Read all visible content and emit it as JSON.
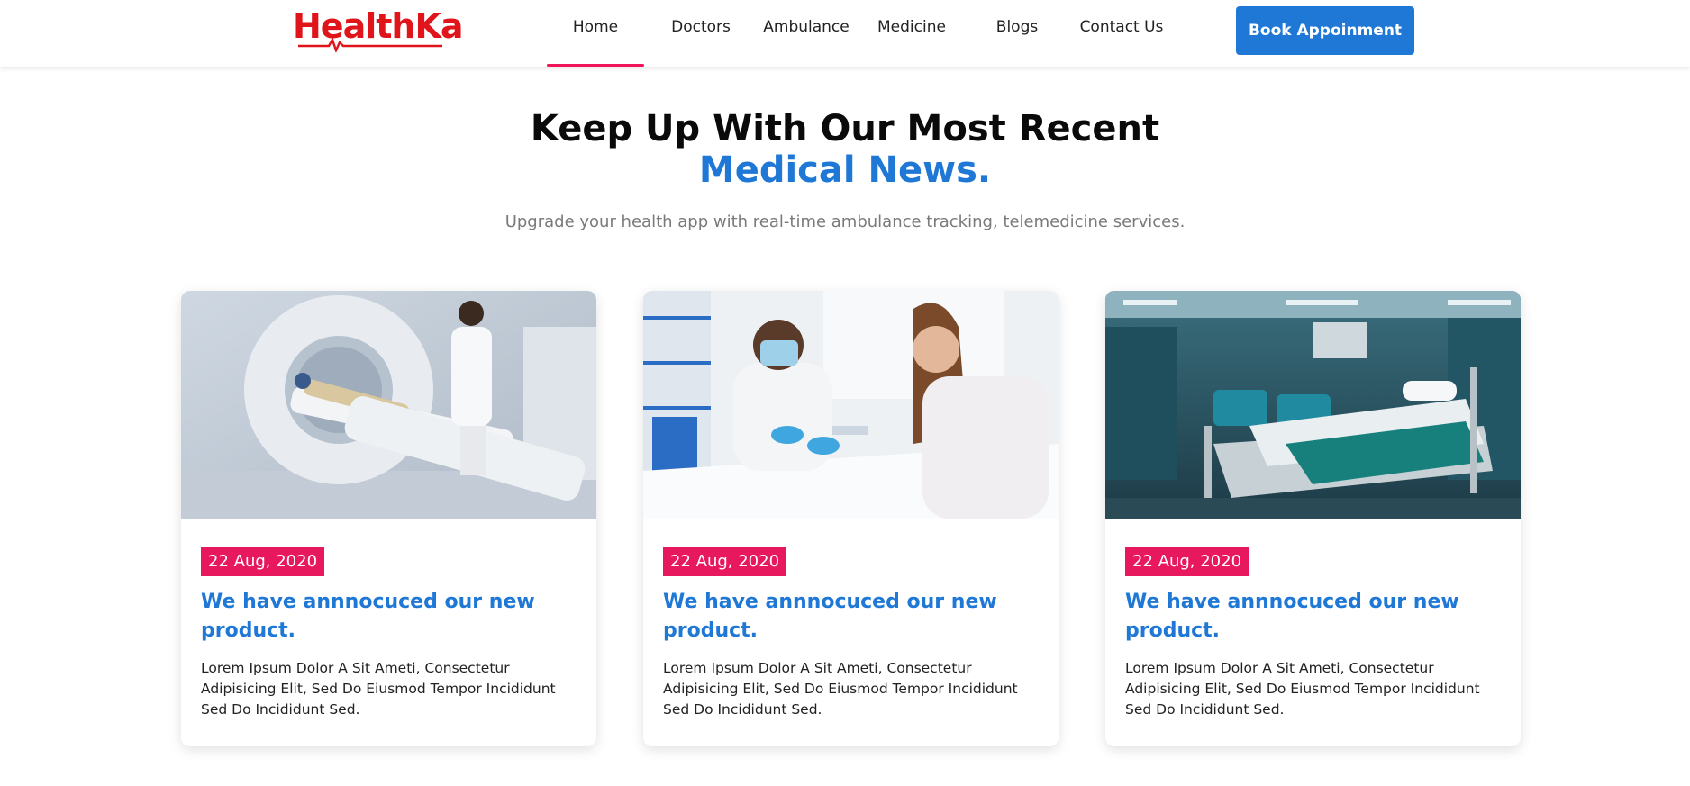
{
  "brand": {
    "logo_part1": "Health",
    "logo_part2": "Ka",
    "colors": {
      "red": "#e0151b",
      "blue": "#1e2fa8"
    }
  },
  "nav": {
    "items": [
      {
        "label": "Home",
        "active": true
      },
      {
        "label": "Doctors"
      },
      {
        "label": "Ambulance"
      },
      {
        "label": "Medicine"
      },
      {
        "label": "Blogs"
      },
      {
        "label": "Contact Us"
      }
    ],
    "cta_label": "Book Appoinment",
    "accent": "#f0145a",
    "cta_color": "#1f78d6"
  },
  "section": {
    "title_line1": "Keep Up With Our Most Recent",
    "title_line2": "Medical News.",
    "subtitle": "Upgrade your health app with real-time ambulance tracking, telemedicine services."
  },
  "cards": [
    {
      "image_alt": "ct-scanner-image",
      "date": "22 Aug, 2020",
      "title": "We have annnocuced our new product.",
      "text": "Lorem Ipsum Dolor A Sit Ameti, Consectetur Adipisicing Elit, Sed Do Eiusmod Tempor Incididunt Sed Do Incididunt Sed."
    },
    {
      "image_alt": "doctor-consultation-image",
      "date": "22 Aug, 2020",
      "title": "We have annnocuced our new product.",
      "text": "Lorem Ipsum Dolor A Sit Ameti, Consectetur Adipisicing Elit, Sed Do Eiusmod Tempor Incididunt Sed Do Incididunt Sed."
    },
    {
      "image_alt": "hospital-room-image",
      "date": "22 Aug, 2020",
      "title": "We have annnocuced our new product.",
      "text": "Lorem Ipsum Dolor A Sit Ameti, Consectetur Adipisicing Elit, Sed Do Eiusmod Tempor Incididunt Sed Do Incididunt Sed."
    }
  ]
}
